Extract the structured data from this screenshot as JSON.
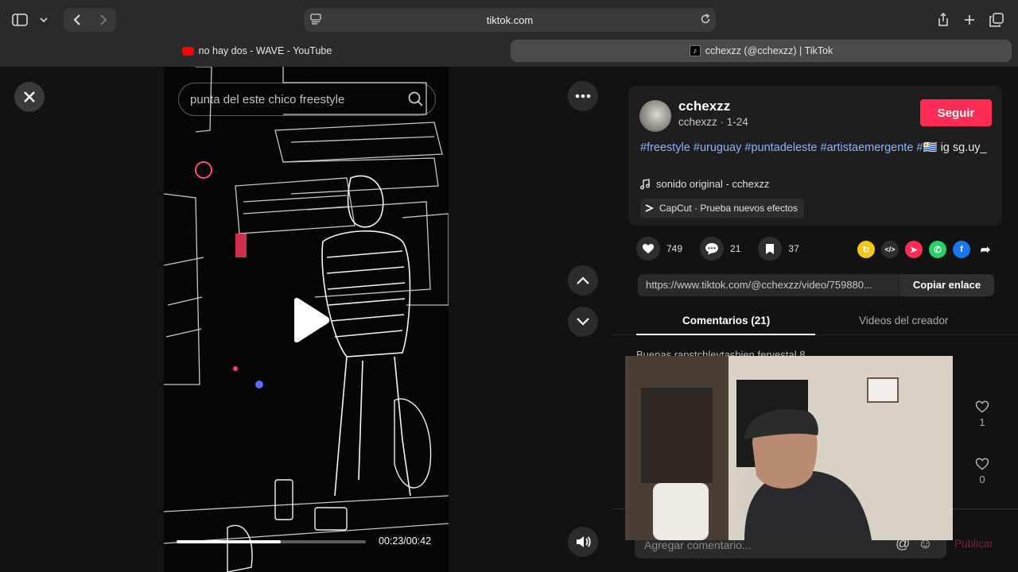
{
  "browser": {
    "address": "tiktok.com",
    "tabs": [
      {
        "label": "no hay dos - WAVE - YouTube",
        "active": false
      },
      {
        "label": "cchexzz (@cchexzz) | TikTok",
        "active": true
      }
    ]
  },
  "video": {
    "search_text": "punta del este chico freestyle",
    "progress_fraction": 0.55,
    "time": "00:23/00:42"
  },
  "post": {
    "username": "cchexzz",
    "subline": "cchexzz · 1-24",
    "follow_label": "Seguir",
    "hashtags": "#freestyle #uruguay #puntadeleste #artistaemergente #🇺🇾",
    "desc_rest": " ig sg.uy_",
    "sound": "sonido original - cchexzz",
    "capcut": "CapCut · Prueba nuevos efectos",
    "likes": "749",
    "comments": "21",
    "saves": "37",
    "link": "https://www.tiktok.com/@cchexzz/video/759880...",
    "copy_label": "Copiar enlace"
  },
  "tabs": {
    "comments_label": "Comentarios (21)",
    "creator_label": "Videos del creador"
  },
  "comments": {
    "peek_text": "Buenas rapstchleytasbien fervestal 8",
    "like_counts": [
      "1",
      "0"
    ],
    "input_placeholder": "Agregar comentario...",
    "publish_label": "Publicar"
  },
  "colors": {
    "accent": "#fe2c55",
    "hashtag": "#8ab4f8"
  }
}
